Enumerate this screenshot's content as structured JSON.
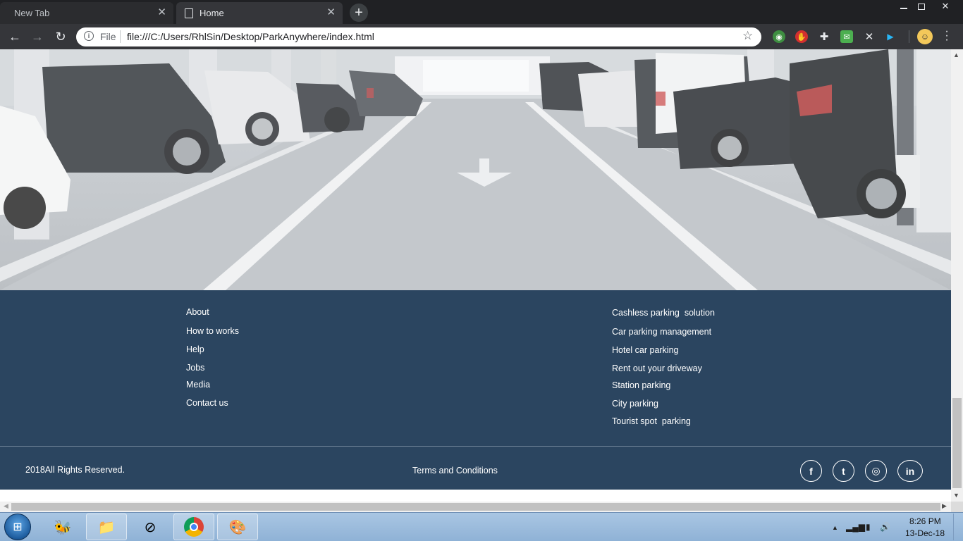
{
  "browser": {
    "tabs": [
      {
        "title": "New Tab",
        "active": false
      },
      {
        "title": "Home",
        "active": true
      }
    ],
    "new_tab_icon": "plus-icon",
    "window_controls": [
      "minimize",
      "restore",
      "close"
    ],
    "nav": {
      "back": "←",
      "forward": "→",
      "reload": "↻"
    },
    "address": {
      "security_label": "File",
      "url": "file:///C:/Users/RhlSin/Desktop/ParkAnywhere/index.html"
    },
    "star_icon": "☆",
    "menu_icon": "⋮"
  },
  "page": {
    "hero_image": "parking-garage-photo",
    "footer": {
      "left_links": [
        "About",
        "How to works",
        "Help",
        "Jobs",
        "Media",
        "Contact us"
      ],
      "right_links": [
        "Cashless parking  solution",
        "Car parking management",
        "Hotel car parking",
        "Rent out your driveway",
        "Station parking",
        "City parking",
        "Tourist spot  parking"
      ],
      "copyright": "2018All Rights Reserved.",
      "terms": "Terms and Conditions",
      "social": [
        {
          "name": "facebook",
          "glyph": "f"
        },
        {
          "name": "twitter",
          "glyph": "t"
        },
        {
          "name": "instagram",
          "glyph": "◎"
        },
        {
          "name": "linkedin",
          "glyph": "in"
        }
      ],
      "colors": {
        "background": "#2b4560",
        "text": "#ffffff"
      }
    }
  },
  "taskbar": {
    "clock": {
      "time": "8:26 PM",
      "date": "13-Dec-18"
    }
  }
}
